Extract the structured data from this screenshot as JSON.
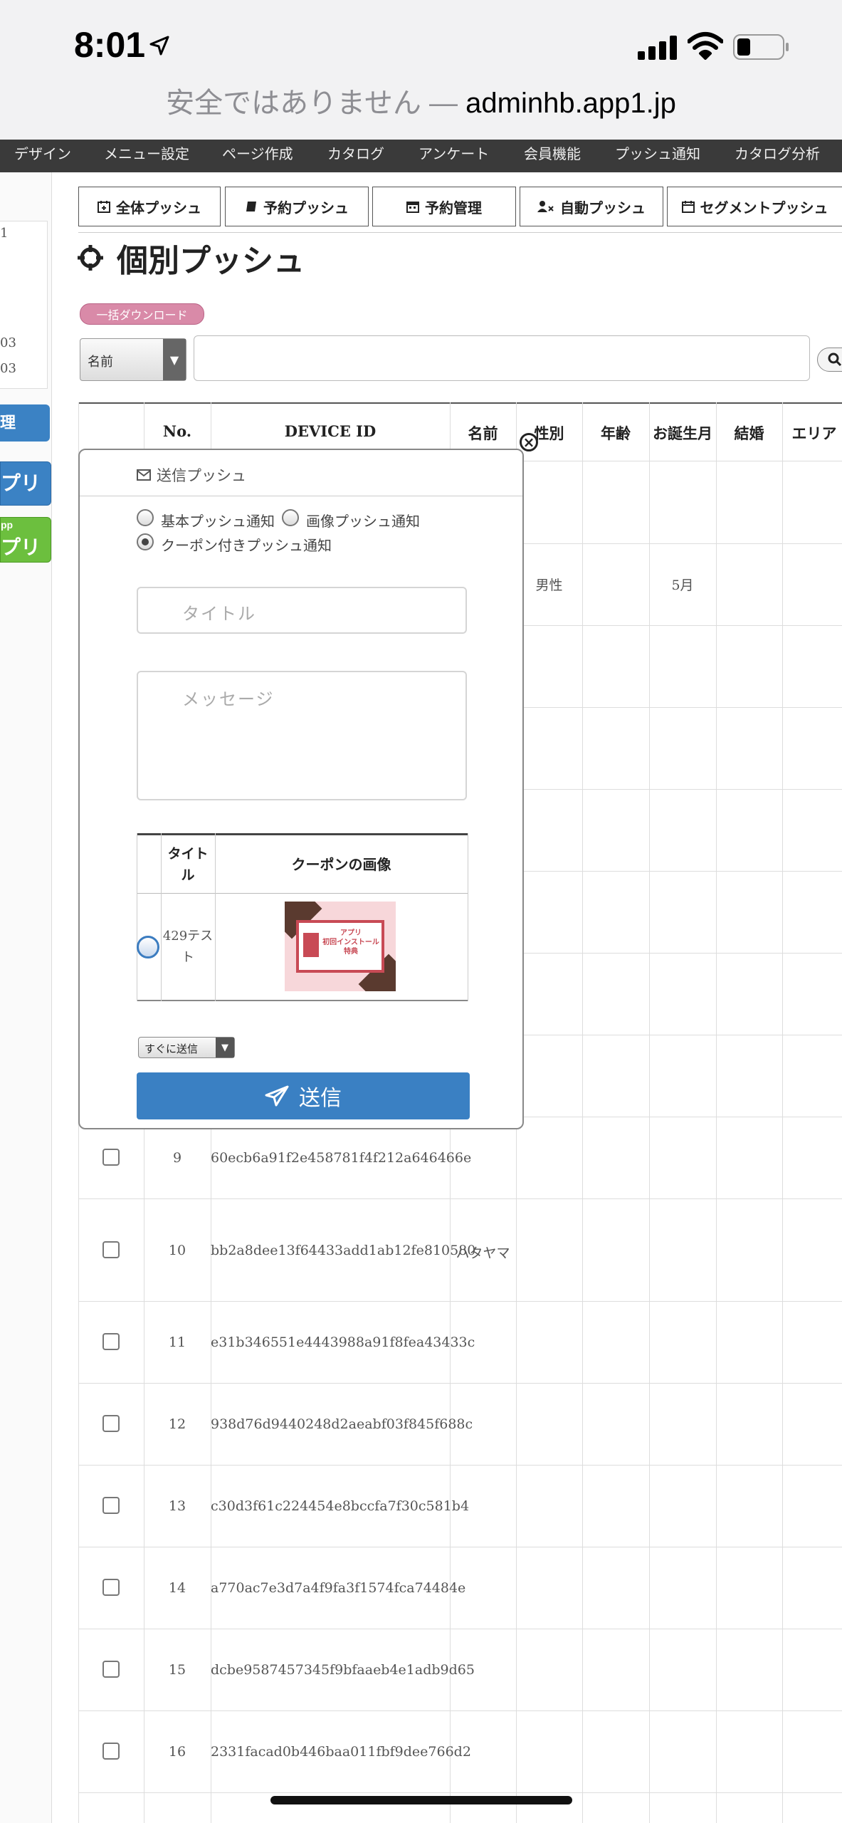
{
  "status_bar": {
    "time": "8:01"
  },
  "url_bar": {
    "insecure_label": "安全ではありません —",
    "domain": "adminhb.app1.jp"
  },
  "top_menu": [
    "デザイン",
    "メニュー設定",
    "ページ作成",
    "カタログ",
    "アンケート",
    "会員機能",
    "プッシュ通知",
    "カタログ分析"
  ],
  "sidebar": {
    "panel_lines": [
      "1",
      "03",
      "03"
    ],
    "blue_label": "理",
    "app_button_1": "プリ",
    "app_button_2_small": "pp",
    "app_button_2": "プリ"
  },
  "tabs": [
    "全体プッシュ",
    "予約プッシュ",
    "予約管理",
    "自動プッシュ",
    "セグメントプッシュ"
  ],
  "page_title": "個別プッシュ",
  "bulk_download": "一括ダウンロード",
  "search": {
    "field_select": "名前",
    "value": ""
  },
  "table": {
    "headers": [
      "No.",
      "DEVICE ID",
      "名前",
      "性別",
      "年齢",
      "お誕生月",
      "結婚",
      "エリア"
    ],
    "visible_partial_row": {
      "gender": "男性",
      "birth_month": "5月"
    },
    "rows": [
      {
        "no": "9",
        "device_id": "60ecb6a91f2e458781f4f212a646466e",
        "name": ""
      },
      {
        "no": "10",
        "device_id": "bb2a8dee13f64433add1ab12fe810580",
        "name": "ハタヤマ"
      },
      {
        "no": "11",
        "device_id": "e31b346551e4443988a91f8fea43433c",
        "name": ""
      },
      {
        "no": "12",
        "device_id": "938d76d9440248d2aeabf03f845f688c",
        "name": ""
      },
      {
        "no": "13",
        "device_id": "c30d3f61c224454e8bccfa7f30c581b4",
        "name": ""
      },
      {
        "no": "14",
        "device_id": "a770ac7e3d7a4f9fa3f1574fca74484e",
        "name": ""
      },
      {
        "no": "15",
        "device_id": "dcbe9587457345f9bfaaeb4e1adb9d65",
        "name": ""
      },
      {
        "no": "16",
        "device_id": "2331facad0b446baa011fbf9dee766d2",
        "name": ""
      }
    ]
  },
  "modal": {
    "header": "送信プッシュ",
    "options": [
      "基本プッシュ通知",
      "画像プッシュ通知",
      "クーポン付きプッシュ通知"
    ],
    "selected_option": "クーポン付きプッシュ通知",
    "title_placeholder": "タイトル",
    "message_placeholder": "メッセージ",
    "coupon_table": {
      "col_title": "タイトル",
      "col_image": "クーポンの画像",
      "row_title": "429テスト",
      "image_text": [
        "アプリ",
        "初回インストール",
        "特典"
      ]
    },
    "send_timing": "すぐに送信",
    "send_button": "送信"
  }
}
